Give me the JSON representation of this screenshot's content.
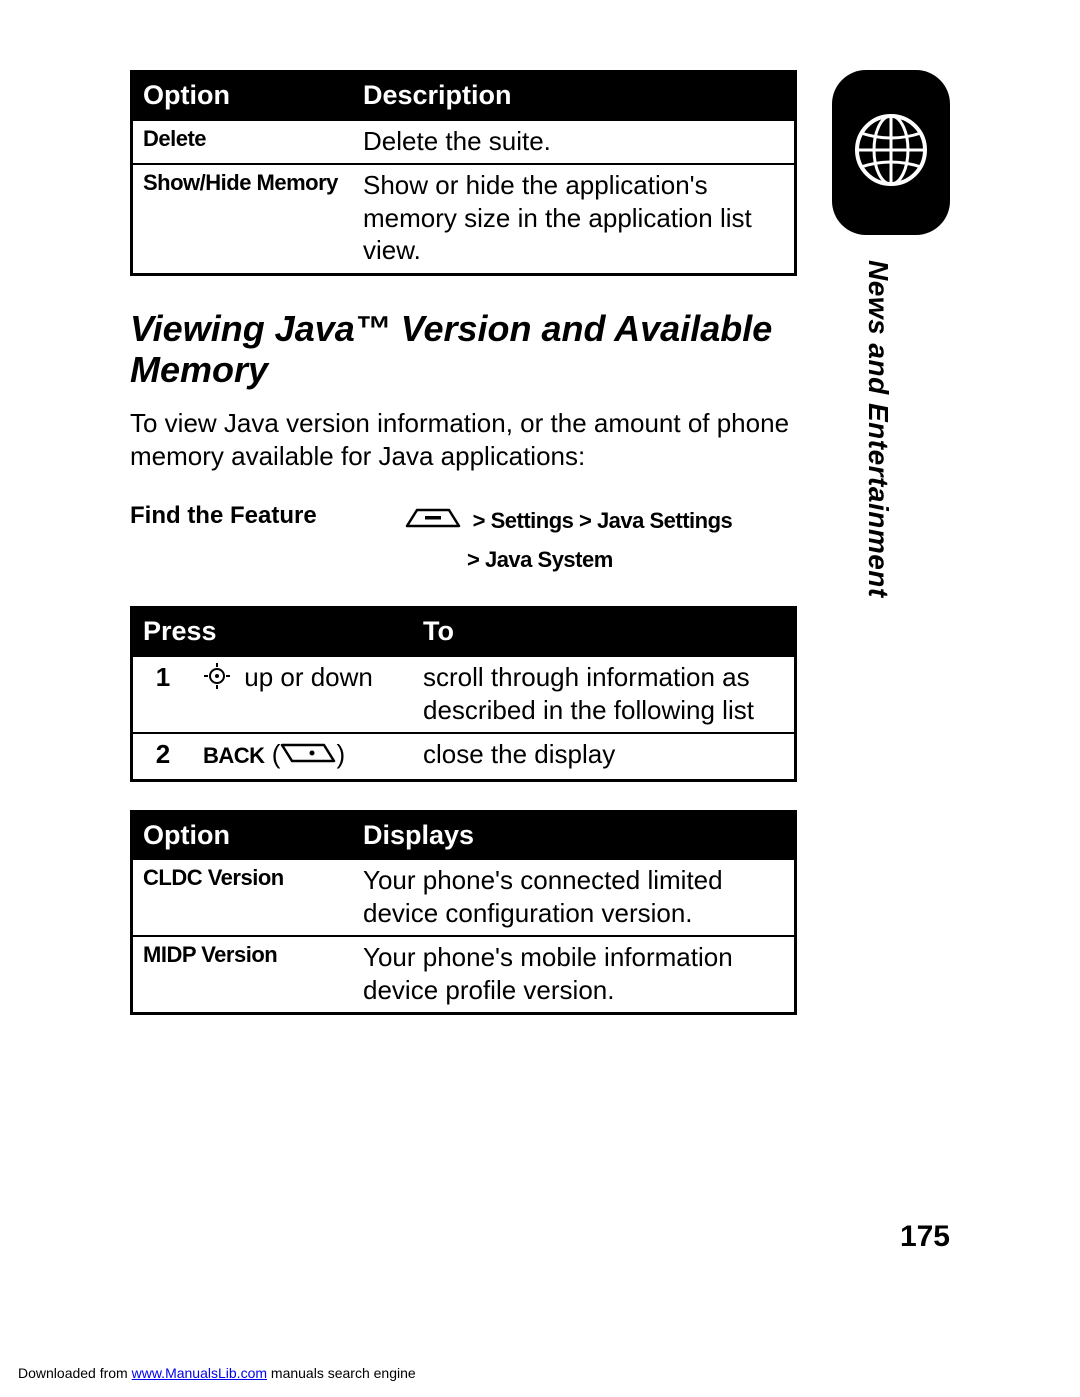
{
  "tables": {
    "options1": {
      "headers": [
        "Option",
        "Description"
      ],
      "rows": [
        {
          "opt": "Delete",
          "desc": "Delete the suite."
        },
        {
          "opt": "Show/Hide Memory",
          "desc": "Show or hide the application's memory size in the application list view."
        }
      ]
    },
    "press": {
      "headers": [
        "Press",
        "To"
      ],
      "rows": [
        {
          "num": "1",
          "key": "up or down",
          "to": "scroll through information as described in the following list"
        },
        {
          "num": "2",
          "key_bold": "BACK",
          "key_suffix": "(",
          "key_suffix2": ")",
          "to": "close the display"
        }
      ]
    },
    "options2": {
      "headers": [
        "Option",
        "Displays"
      ],
      "rows": [
        {
          "opt": "CLDC Version",
          "desc": "Your phone's connected limited device configuration version."
        },
        {
          "opt": "MIDP Version",
          "desc": "Your phone's mobile information device profile version."
        }
      ]
    }
  },
  "section_heading": "Viewing Java™ Version and Available Memory",
  "intro_para": "To view Java version information, or the amount of phone memory available for Java applications:",
  "feature": {
    "label": "Find the Feature",
    "line1": "> Settings > Java Settings",
    "line2": "> Java System"
  },
  "side_section": "News and Entertainment",
  "page_number": "175",
  "footer": {
    "prefix": "Downloaded from ",
    "link": "www.ManualsLib.com",
    "suffix": " manuals search engine"
  }
}
